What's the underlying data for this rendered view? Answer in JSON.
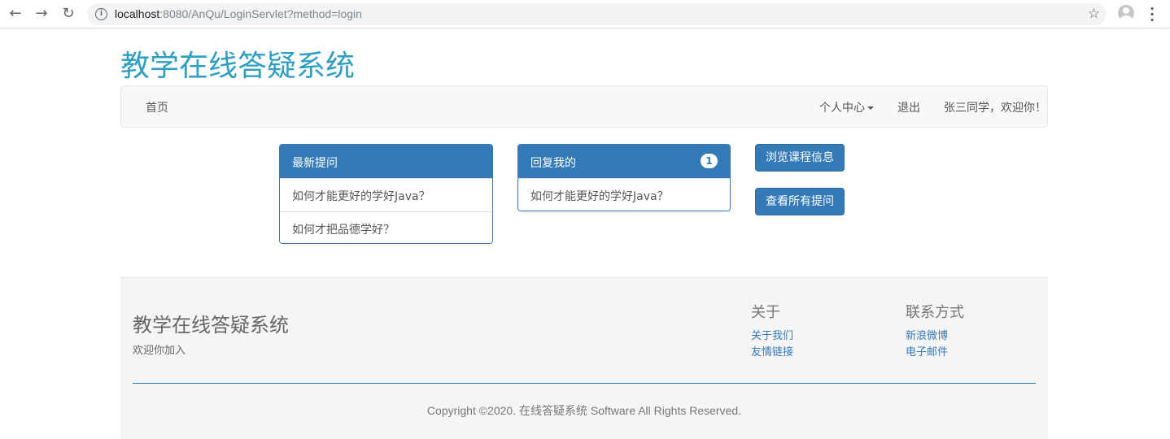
{
  "browser": {
    "url_host": "localhost",
    "url_rest": ":8080/AnQu/LoginServlet?method=login"
  },
  "site": {
    "title": "教学在线答疑系统"
  },
  "navbar": {
    "home": "首页",
    "personal_center": "个人中心",
    "logout": "退出",
    "welcome": "张三同学，欢迎你！"
  },
  "latest_questions": {
    "heading": "最新提问",
    "items": [
      {
        "text": "如何才能更好的学好Java？"
      },
      {
        "text": "如何才把品德学好？"
      }
    ]
  },
  "replies": {
    "heading": "回复我的",
    "badge": "1",
    "items": [
      {
        "text": "如何才能更好的学好Java？"
      }
    ]
  },
  "actions": {
    "browse_courses": "浏览课程信息",
    "view_all_questions": "查看所有提问"
  },
  "footer": {
    "title": "教学在线答疑系统",
    "subtitle": "欢迎你加入",
    "about": {
      "heading": "关于",
      "links": [
        "关于我们",
        "友情链接"
      ]
    },
    "contact": {
      "heading": "联系方式",
      "links": [
        "新浪微博",
        "电子邮件"
      ]
    },
    "copyright": "Copyright ©2020. 在线答疑系统 Software All Rights Reserved."
  },
  "colors": {
    "brand_title": "#2e9ec1",
    "primary": "#337ab7"
  }
}
